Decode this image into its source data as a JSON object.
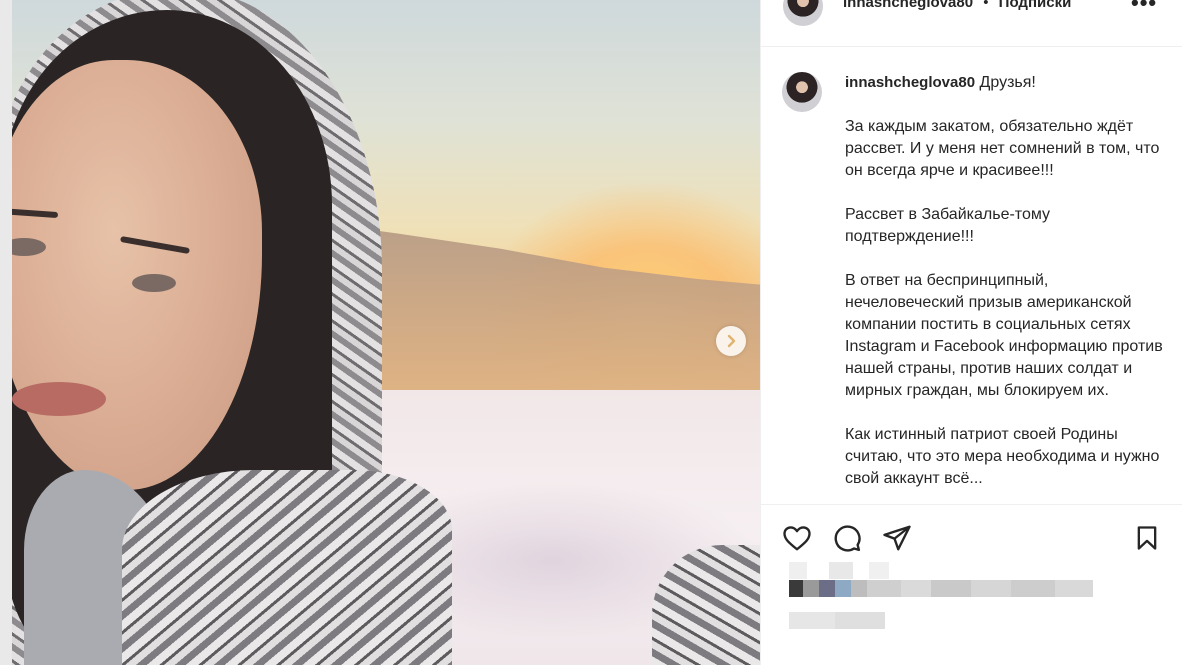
{
  "post": {
    "username": "innashcheglova80",
    "separator": "•",
    "follow_label": "Подписки",
    "more_label": "•••",
    "caption_lead": "Друзья!",
    "caption_paragraphs": [
      "За каждым закатом, обязательно ждёт рассвет. И у меня нет сомнений в том, что он всегда ярче и красивее!!!",
      "Рассвет в Забайкалье-тому подтверждение!!!",
      "В ответ на беспринципный, нечеловеческий призыв американской компании постить в социальных сетях Instagram и Facebook информацию против нашей страны, против наших солдат и мирных граждан, мы блокируем их.",
      "Как истинный патриот своей Родины считаю, что это мера необходима и нужно свой аккаунт всё..."
    ]
  },
  "icons": {
    "like": "heart-icon",
    "comment": "comment-icon",
    "share": "share-icon",
    "save": "bookmark-icon",
    "next": "chevron-right-icon"
  },
  "colors": {
    "text": "#262626",
    "border": "#efefef",
    "blur_gray": "#d6d6d6"
  }
}
